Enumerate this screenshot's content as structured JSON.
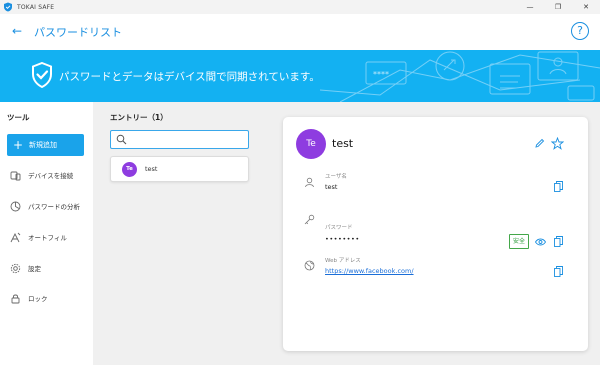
{
  "app": {
    "window_title": "TOKAI SAFE"
  },
  "window_controls": {
    "minimize": "—",
    "maximize": "❐",
    "close": "✕"
  },
  "header": {
    "back": "←",
    "title": "パスワードリスト",
    "help": "?"
  },
  "banner": {
    "text": "パスワードとデータはデバイス間で同期されています。",
    "deco_stars": "****"
  },
  "sidebar": {
    "title": "ツール",
    "add_button": "新規追加",
    "items": [
      {
        "label": "デバイスを接続",
        "icon": "device-icon"
      },
      {
        "label": "パスワードの分析",
        "icon": "analysis-icon"
      },
      {
        "label": "オートフィル",
        "icon": "autofill-icon"
      },
      {
        "label": "設定",
        "icon": "gear-icon"
      },
      {
        "label": "ロック",
        "icon": "lock-icon"
      }
    ]
  },
  "entries": {
    "title": "エントリー（1）",
    "search_placeholder": "",
    "items": [
      {
        "initials": "Te",
        "name": "test"
      }
    ]
  },
  "detail": {
    "initials": "Te",
    "title": "test",
    "fields": {
      "username": {
        "label": "ユーザ名",
        "value": "test"
      },
      "password": {
        "label": "パスワード",
        "value": "••••••••",
        "strength": "安全"
      },
      "web": {
        "label": "Web アドレス",
        "value": "https://www.facebook.com/"
      }
    }
  },
  "colors": {
    "accent": "#1a8fe0",
    "banner": "#13b1f2",
    "avatar": "#8e3ce0",
    "safe": "#2e9c3c"
  }
}
